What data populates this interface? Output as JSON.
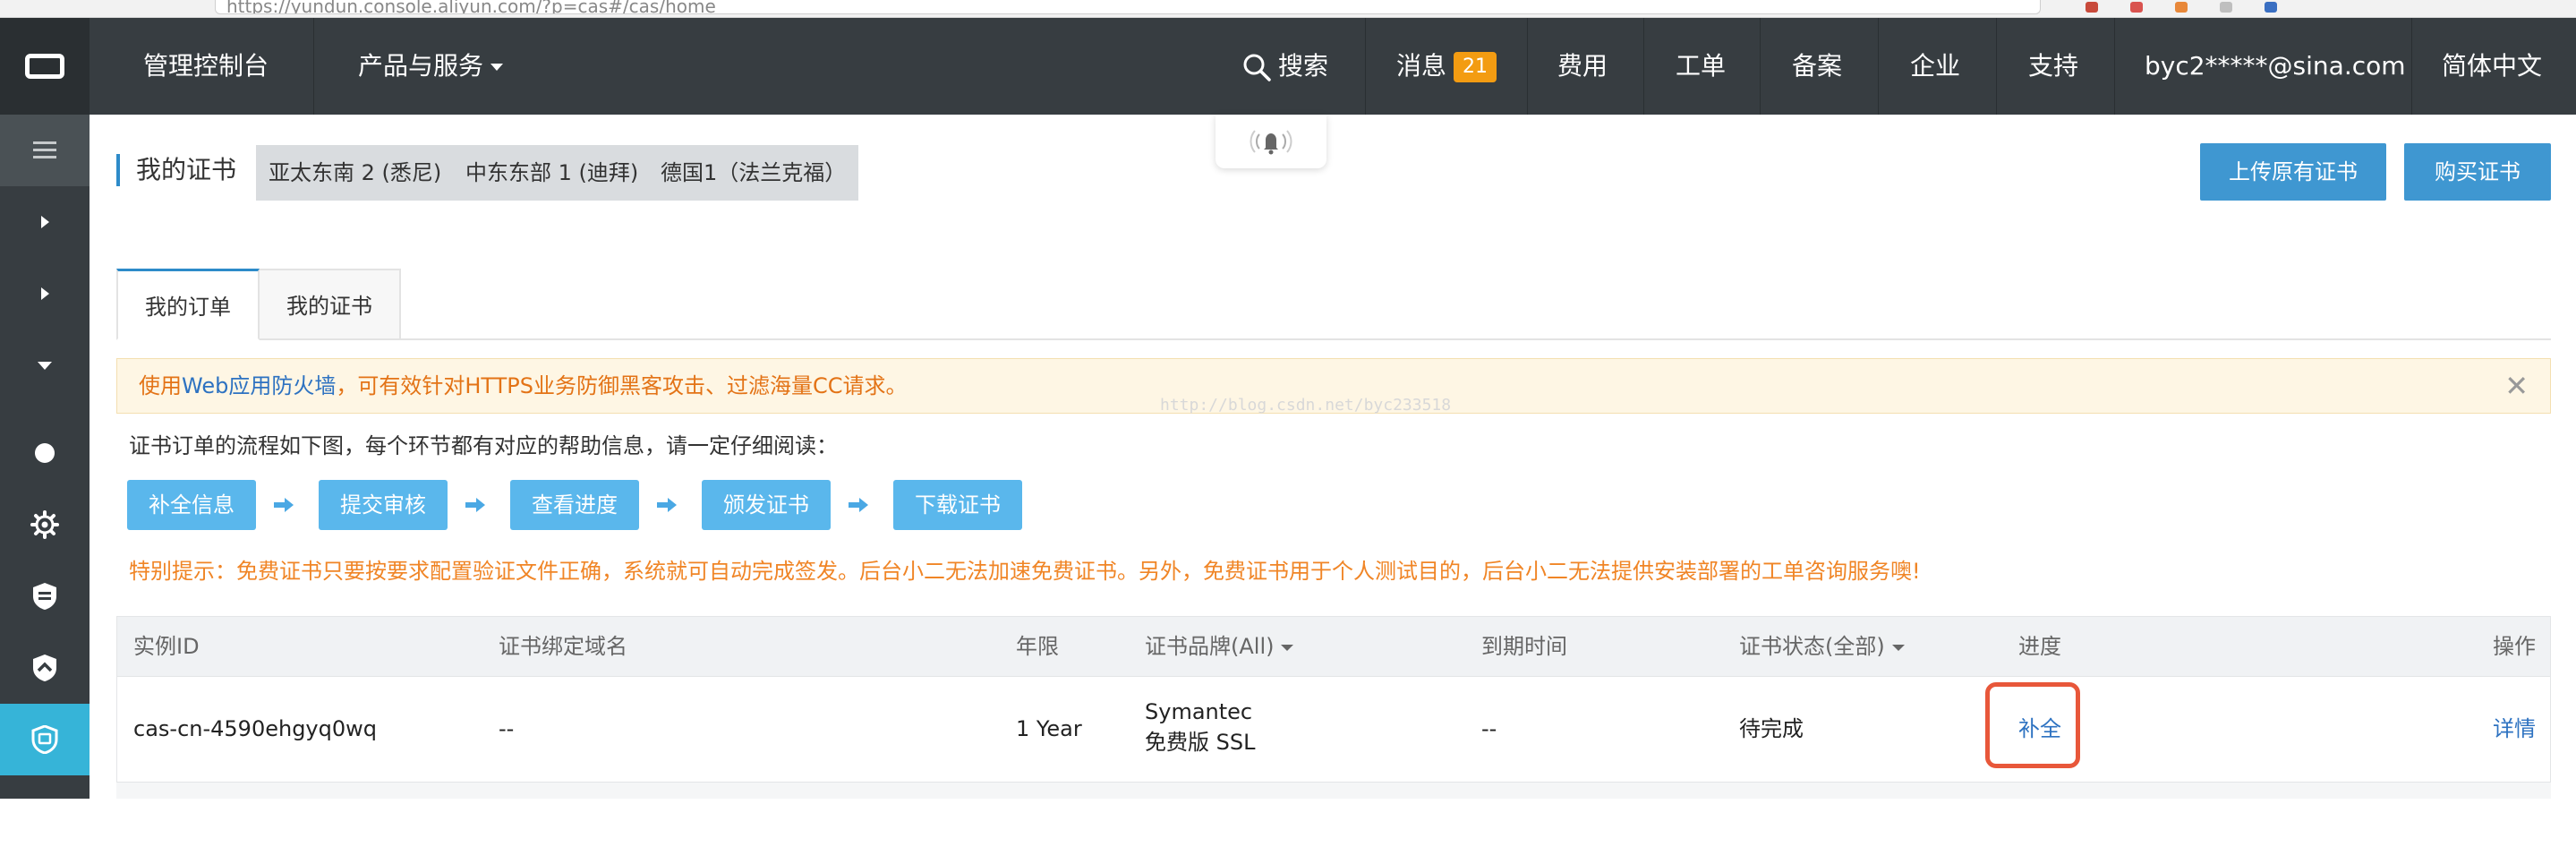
{
  "browser": {
    "url": "https://yundun.console.aliyun.com/?p=cas#/cas/home"
  },
  "nav": {
    "console": "管理控制台",
    "products": "产品与服务",
    "search": "搜索",
    "messages": "消息",
    "message_count": "21",
    "billing": "费用",
    "tickets": "工单",
    "icp": "备案",
    "enterprise": "企业",
    "support": "支持",
    "account": "byc2*****@sina.com",
    "language": "简体中文"
  },
  "page": {
    "title": "我的证书",
    "regions": [
      "亚太东南 2 (悉尼)",
      "中东东部 1 (迪拜)",
      "德国1（法兰克福）"
    ],
    "upload_button": "上传原有证书",
    "buy_button": "购买证书",
    "tabs": [
      "我的订单",
      "我的证书"
    ],
    "notice": {
      "prefix": "使用",
      "link": "Web应用防火墙",
      "suffix": "，可有效针对HTTPS业务防御黑客攻击、过滤海量CC请求。"
    },
    "watermark": "http://blog.csdn.net/byc233518",
    "flow_intro": "证书订单的流程如下图，每个环节都有对应的帮助信息，请一定仔细阅读：",
    "flow_steps": [
      "补全信息",
      "提交审核",
      "查看进度",
      "颁发证书",
      "下载证书"
    ],
    "tip": "特别提示：免费证书只要按要求配置验证文件正确，系统就可自动完成签发。后台小二无法加速免费证书。另外，免费证书用于个人测试目的，后台小二无法提供安装部署的工单咨询服务噢!"
  },
  "table": {
    "headers": {
      "id": "实例ID",
      "domain": "证书绑定域名",
      "term": "年限",
      "brand": "证书品牌(All)",
      "expiry": "到期时间",
      "status": "证书状态(全部)",
      "progress": "进度",
      "action": "操作"
    },
    "rows": [
      {
        "id": "cas-cn-4590ehgyq0wq",
        "domain": "--",
        "term": "1 Year",
        "brand_line1": "Symantec",
        "brand_line2": "免费版 SSL",
        "expiry": "--",
        "status": "待完成",
        "progress": "补全",
        "action": "详情"
      }
    ]
  },
  "colors": {
    "topbar": "#373d41",
    "accent": "#3f97d1",
    "sidebar_active": "#36b4d8",
    "warning_text": "#f08526",
    "highlight": "#e8573a"
  }
}
